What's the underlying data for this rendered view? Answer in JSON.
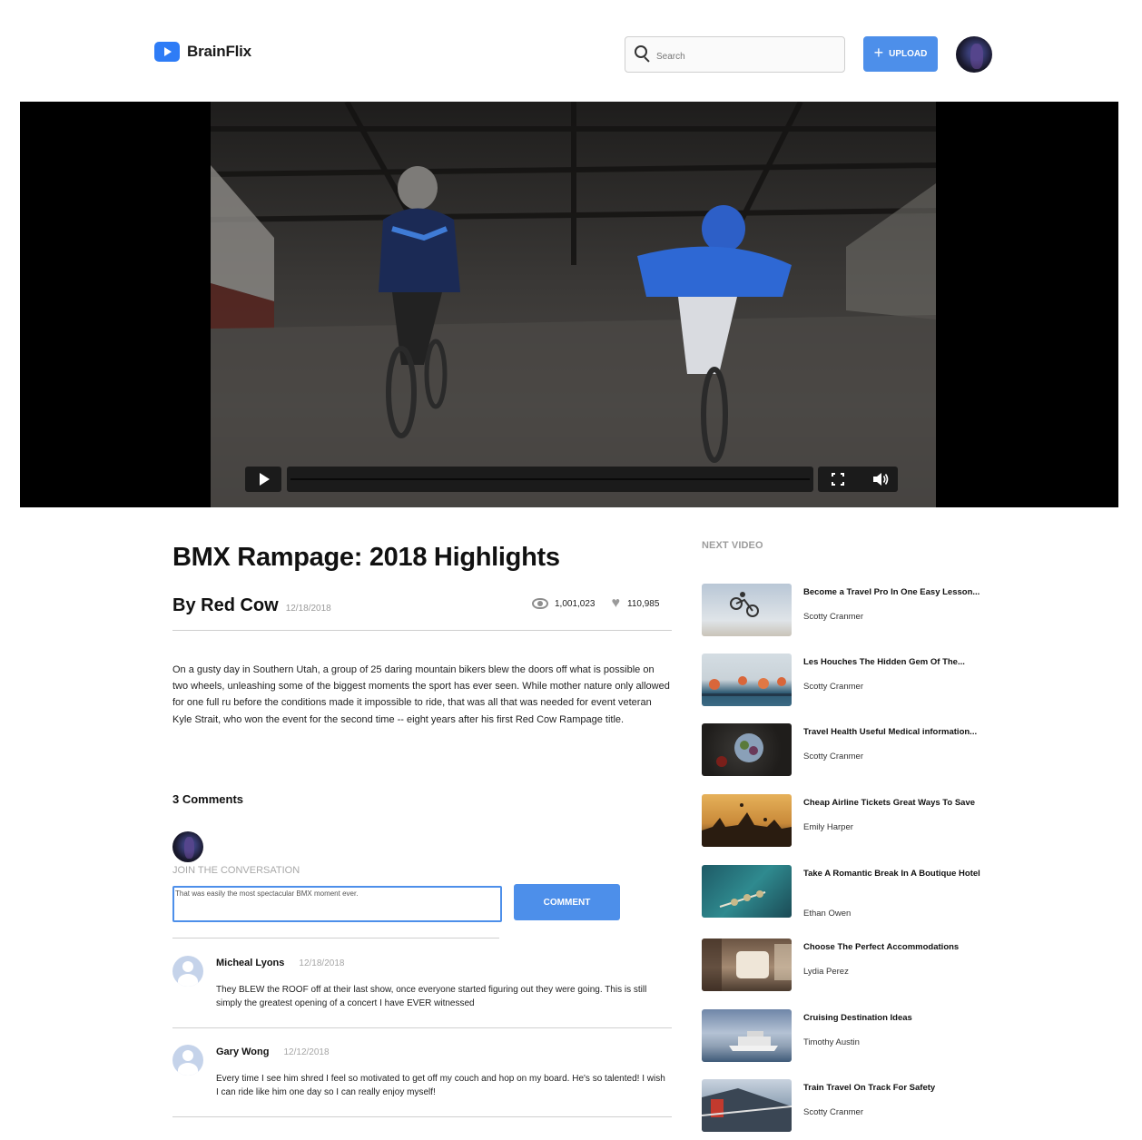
{
  "app": {
    "name": "BrainFlix"
  },
  "header": {
    "search_placeholder": "Search",
    "upload_label": "UPLOAD"
  },
  "video": {
    "title": "BMX Rampage: 2018 Highlights",
    "author": "By Red Cow",
    "date": "12/18/2018",
    "views": "1,001,023",
    "likes": "110,985",
    "description": "On a gusty day in Southern Utah, a group of 25 daring mountain bikers blew the doors off what is possible on two wheels, unleashing some of the biggest moments the sport has ever seen. While mother nature only allowed for one full ru before the conditions made it impossible to ride, that was all that was needed for event veteran Kyle Strait, who won the event for the second time -- eight years after his first Red Cow Rampage title."
  },
  "player": {
    "play_icon": "play-icon",
    "fullscreen_icon": "fullscreen-icon",
    "volume_icon": "volume-icon",
    "progress": 0
  },
  "comments": {
    "count_label": "3 Comments",
    "join_label": "JOIN THE CONVERSATION",
    "input_value": "That was easily the most spectacular BMX moment ever.",
    "button_label": "COMMENT",
    "items": [
      {
        "name": "Micheal Lyons",
        "date": "12/18/2018",
        "text": "They BLEW the ROOF off at their last show, once everyone started figuring out they were going. This is still simply the greatest opening of a concert I have EVER witnessed"
      },
      {
        "name": "Gary Wong",
        "date": "12/12/2018",
        "text": "Every time I see him shred I feel so motivated to get off my couch and hop on my board. He's so talented! I wish I can ride like him one day so I can really enjoy myself!"
      }
    ]
  },
  "next_video": {
    "label": "NEXT VIDEO",
    "items": [
      {
        "title": "Become a Travel Pro In One Easy Lesson...",
        "author": "Scotty Cranmer"
      },
      {
        "title": "Les Houches The Hidden Gem Of The...",
        "author": "Scotty Cranmer"
      },
      {
        "title": "Travel Health Useful Medical information...",
        "author": "Scotty Cranmer"
      },
      {
        "title": "Cheap Airline Tickets Great Ways To Save",
        "author": "Emily Harper"
      },
      {
        "title": "Take A Romantic Break In A Boutique Hotel",
        "author": "Ethan Owen"
      },
      {
        "title": "Choose The Perfect Accommodations",
        "author": "Lydia Perez"
      },
      {
        "title": "Cruising Destination Ideas",
        "author": "Timothy Austin"
      },
      {
        "title": "Train Travel On Track For Safety",
        "author": "Scotty Cranmer"
      }
    ]
  },
  "colors": {
    "accent": "#4D8FEA",
    "logo": "#2E7CF6"
  }
}
